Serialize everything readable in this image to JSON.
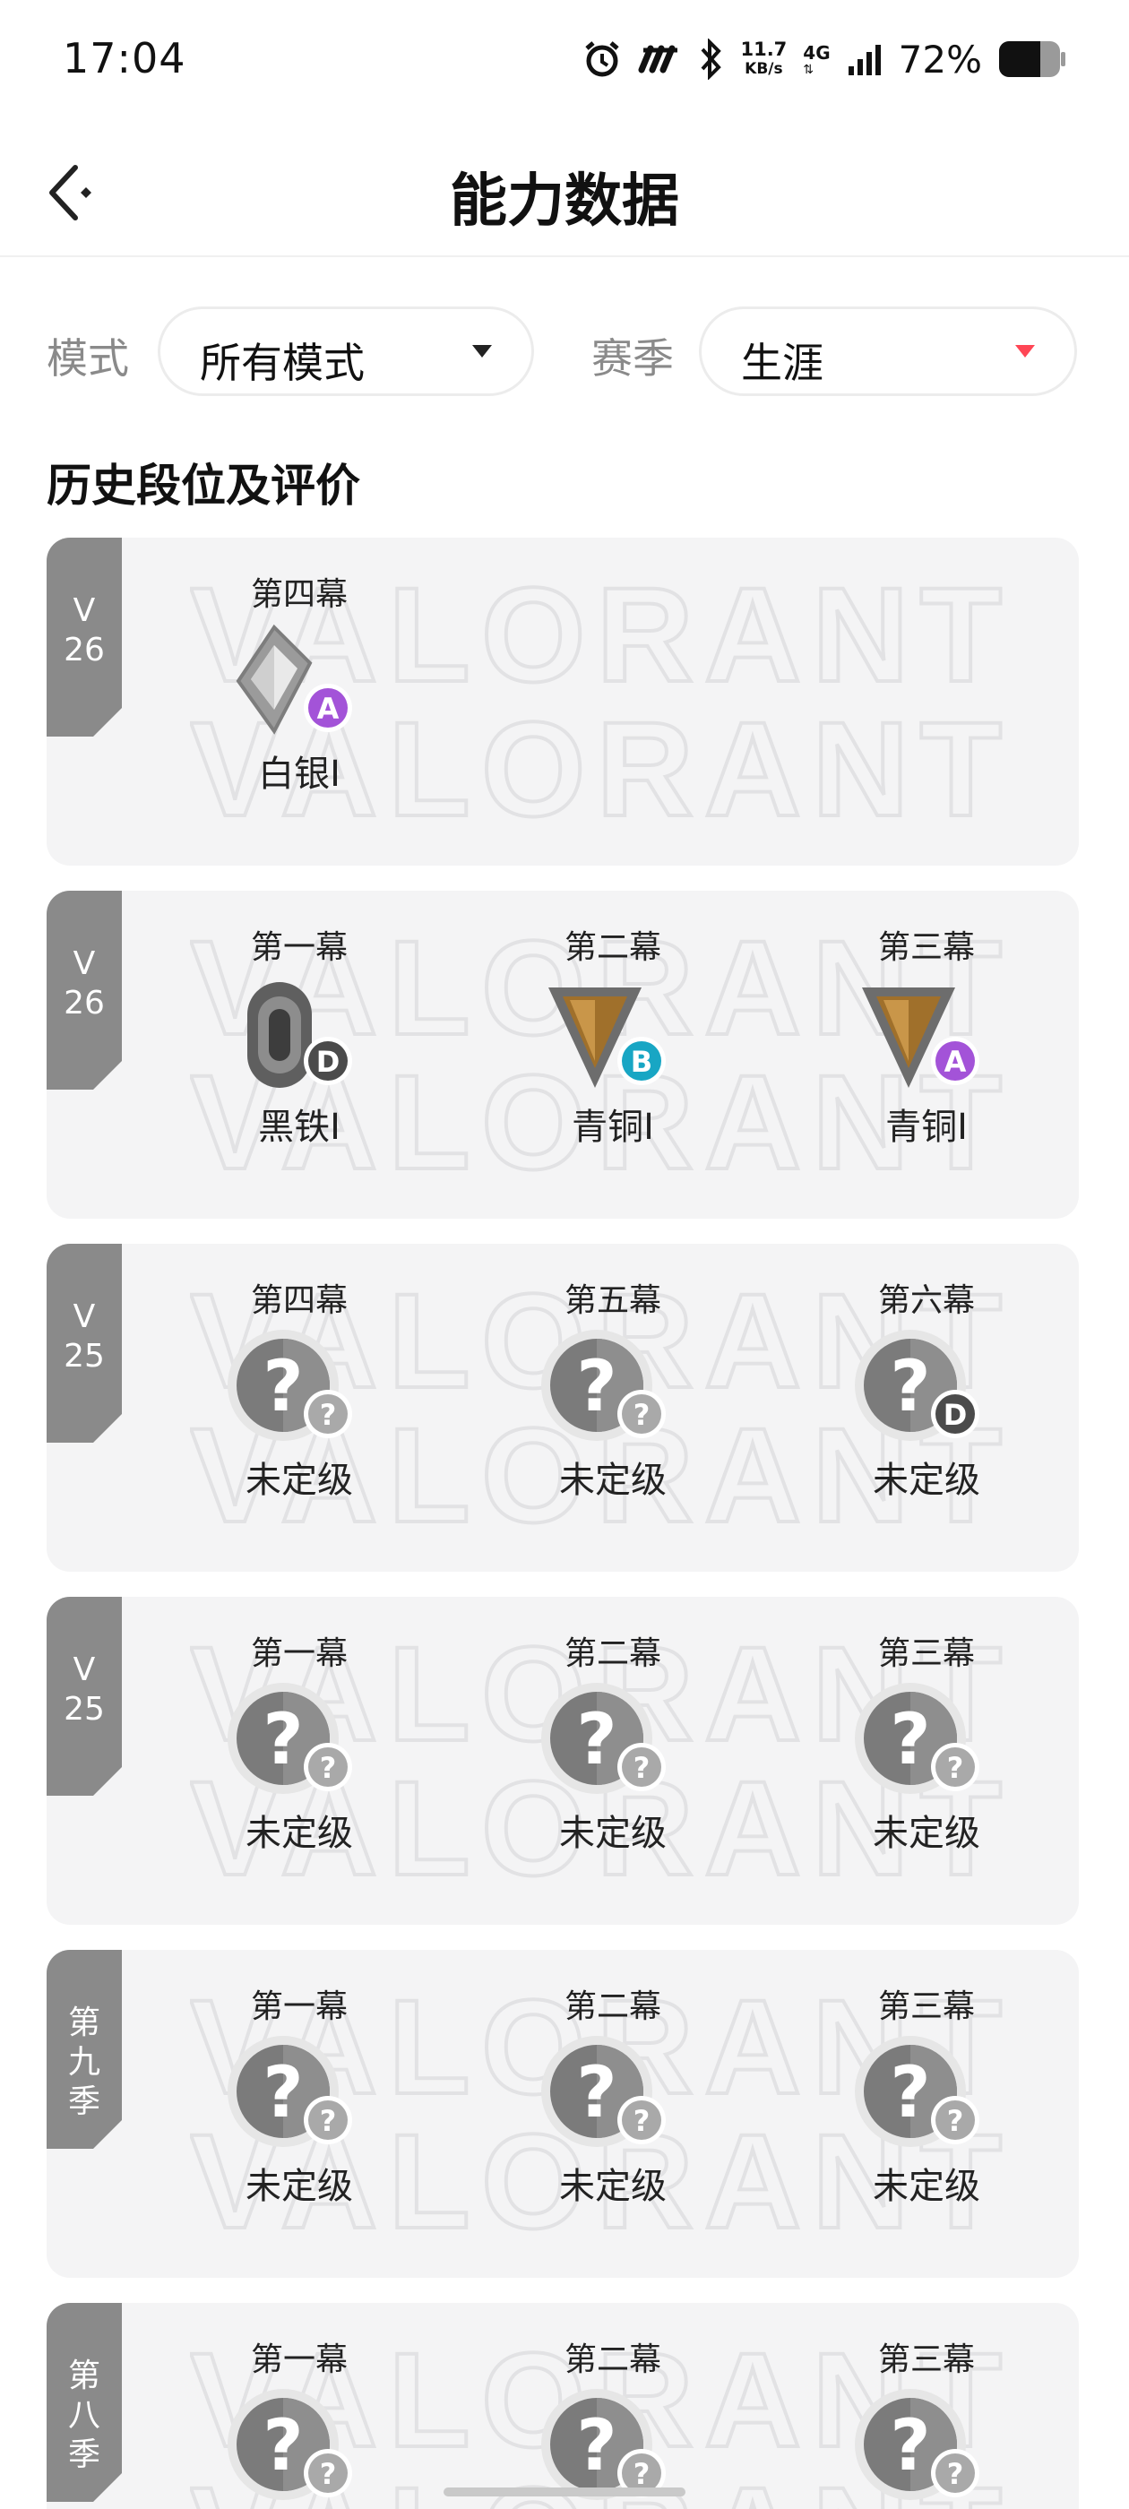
{
  "status_bar": {
    "time": "17:04",
    "net_speed_value": "11.7",
    "net_speed_unit": "KB/s",
    "net_type": "4G",
    "battery": "72%"
  },
  "header": {
    "title": "能力数据",
    "back_icon": "back-arrow-icon"
  },
  "filters": {
    "mode_label": "模式",
    "mode_value": "所有模式",
    "season_label": "赛季",
    "season_value": "生涯"
  },
  "section_title": "历史段位及评价",
  "colors": {
    "accent_red": "#ff4655",
    "tag_gray": "#8a8a8a",
    "grade_a": "#a353d8",
    "grade_b": "#18a6c4",
    "grade_d": "#4b4b4b",
    "grade_unknown": "#a9a9a9"
  },
  "seasons": [
    {
      "tag": "V\n26",
      "acts": [
        {
          "name": "第四幕",
          "rank": "白银I",
          "rank_icon": "silver",
          "grade": "A"
        }
      ]
    },
    {
      "tag": "V\n26",
      "acts": [
        {
          "name": "第一幕",
          "rank": "黑铁I",
          "rank_icon": "iron",
          "grade": "D"
        },
        {
          "name": "第二幕",
          "rank": "青铜I",
          "rank_icon": "bronze",
          "grade": "B"
        },
        {
          "name": "第三幕",
          "rank": "青铜I",
          "rank_icon": "bronze",
          "grade": "A"
        }
      ]
    },
    {
      "tag": "V\n25",
      "acts": [
        {
          "name": "第四幕",
          "rank": "未定级",
          "rank_icon": "unranked",
          "grade": "?"
        },
        {
          "name": "第五幕",
          "rank": "未定级",
          "rank_icon": "unranked",
          "grade": "?"
        },
        {
          "name": "第六幕",
          "rank": "未定级",
          "rank_icon": "unranked",
          "grade": "D"
        }
      ]
    },
    {
      "tag": "V\n25",
      "acts": [
        {
          "name": "第一幕",
          "rank": "未定级",
          "rank_icon": "unranked",
          "grade": "?"
        },
        {
          "name": "第二幕",
          "rank": "未定级",
          "rank_icon": "unranked",
          "grade": "?"
        },
        {
          "name": "第三幕",
          "rank": "未定级",
          "rank_icon": "unranked",
          "grade": "?"
        }
      ]
    },
    {
      "tag": "第\n九\n季",
      "acts": [
        {
          "name": "第一幕",
          "rank": "未定级",
          "rank_icon": "unranked",
          "grade": "?"
        },
        {
          "name": "第二幕",
          "rank": "未定级",
          "rank_icon": "unranked",
          "grade": "?"
        },
        {
          "name": "第三幕",
          "rank": "未定级",
          "rank_icon": "unranked",
          "grade": "?"
        }
      ]
    },
    {
      "tag": "第\n八\n季",
      "acts": [
        {
          "name": "第一幕",
          "rank": "未定级",
          "rank_icon": "unranked",
          "grade": "?"
        },
        {
          "name": "第二幕",
          "rank": "未定级",
          "rank_icon": "unranked",
          "grade": "?"
        },
        {
          "name": "第三幕",
          "rank": "未定级",
          "rank_icon": "unranked",
          "grade": "?"
        }
      ]
    }
  ]
}
